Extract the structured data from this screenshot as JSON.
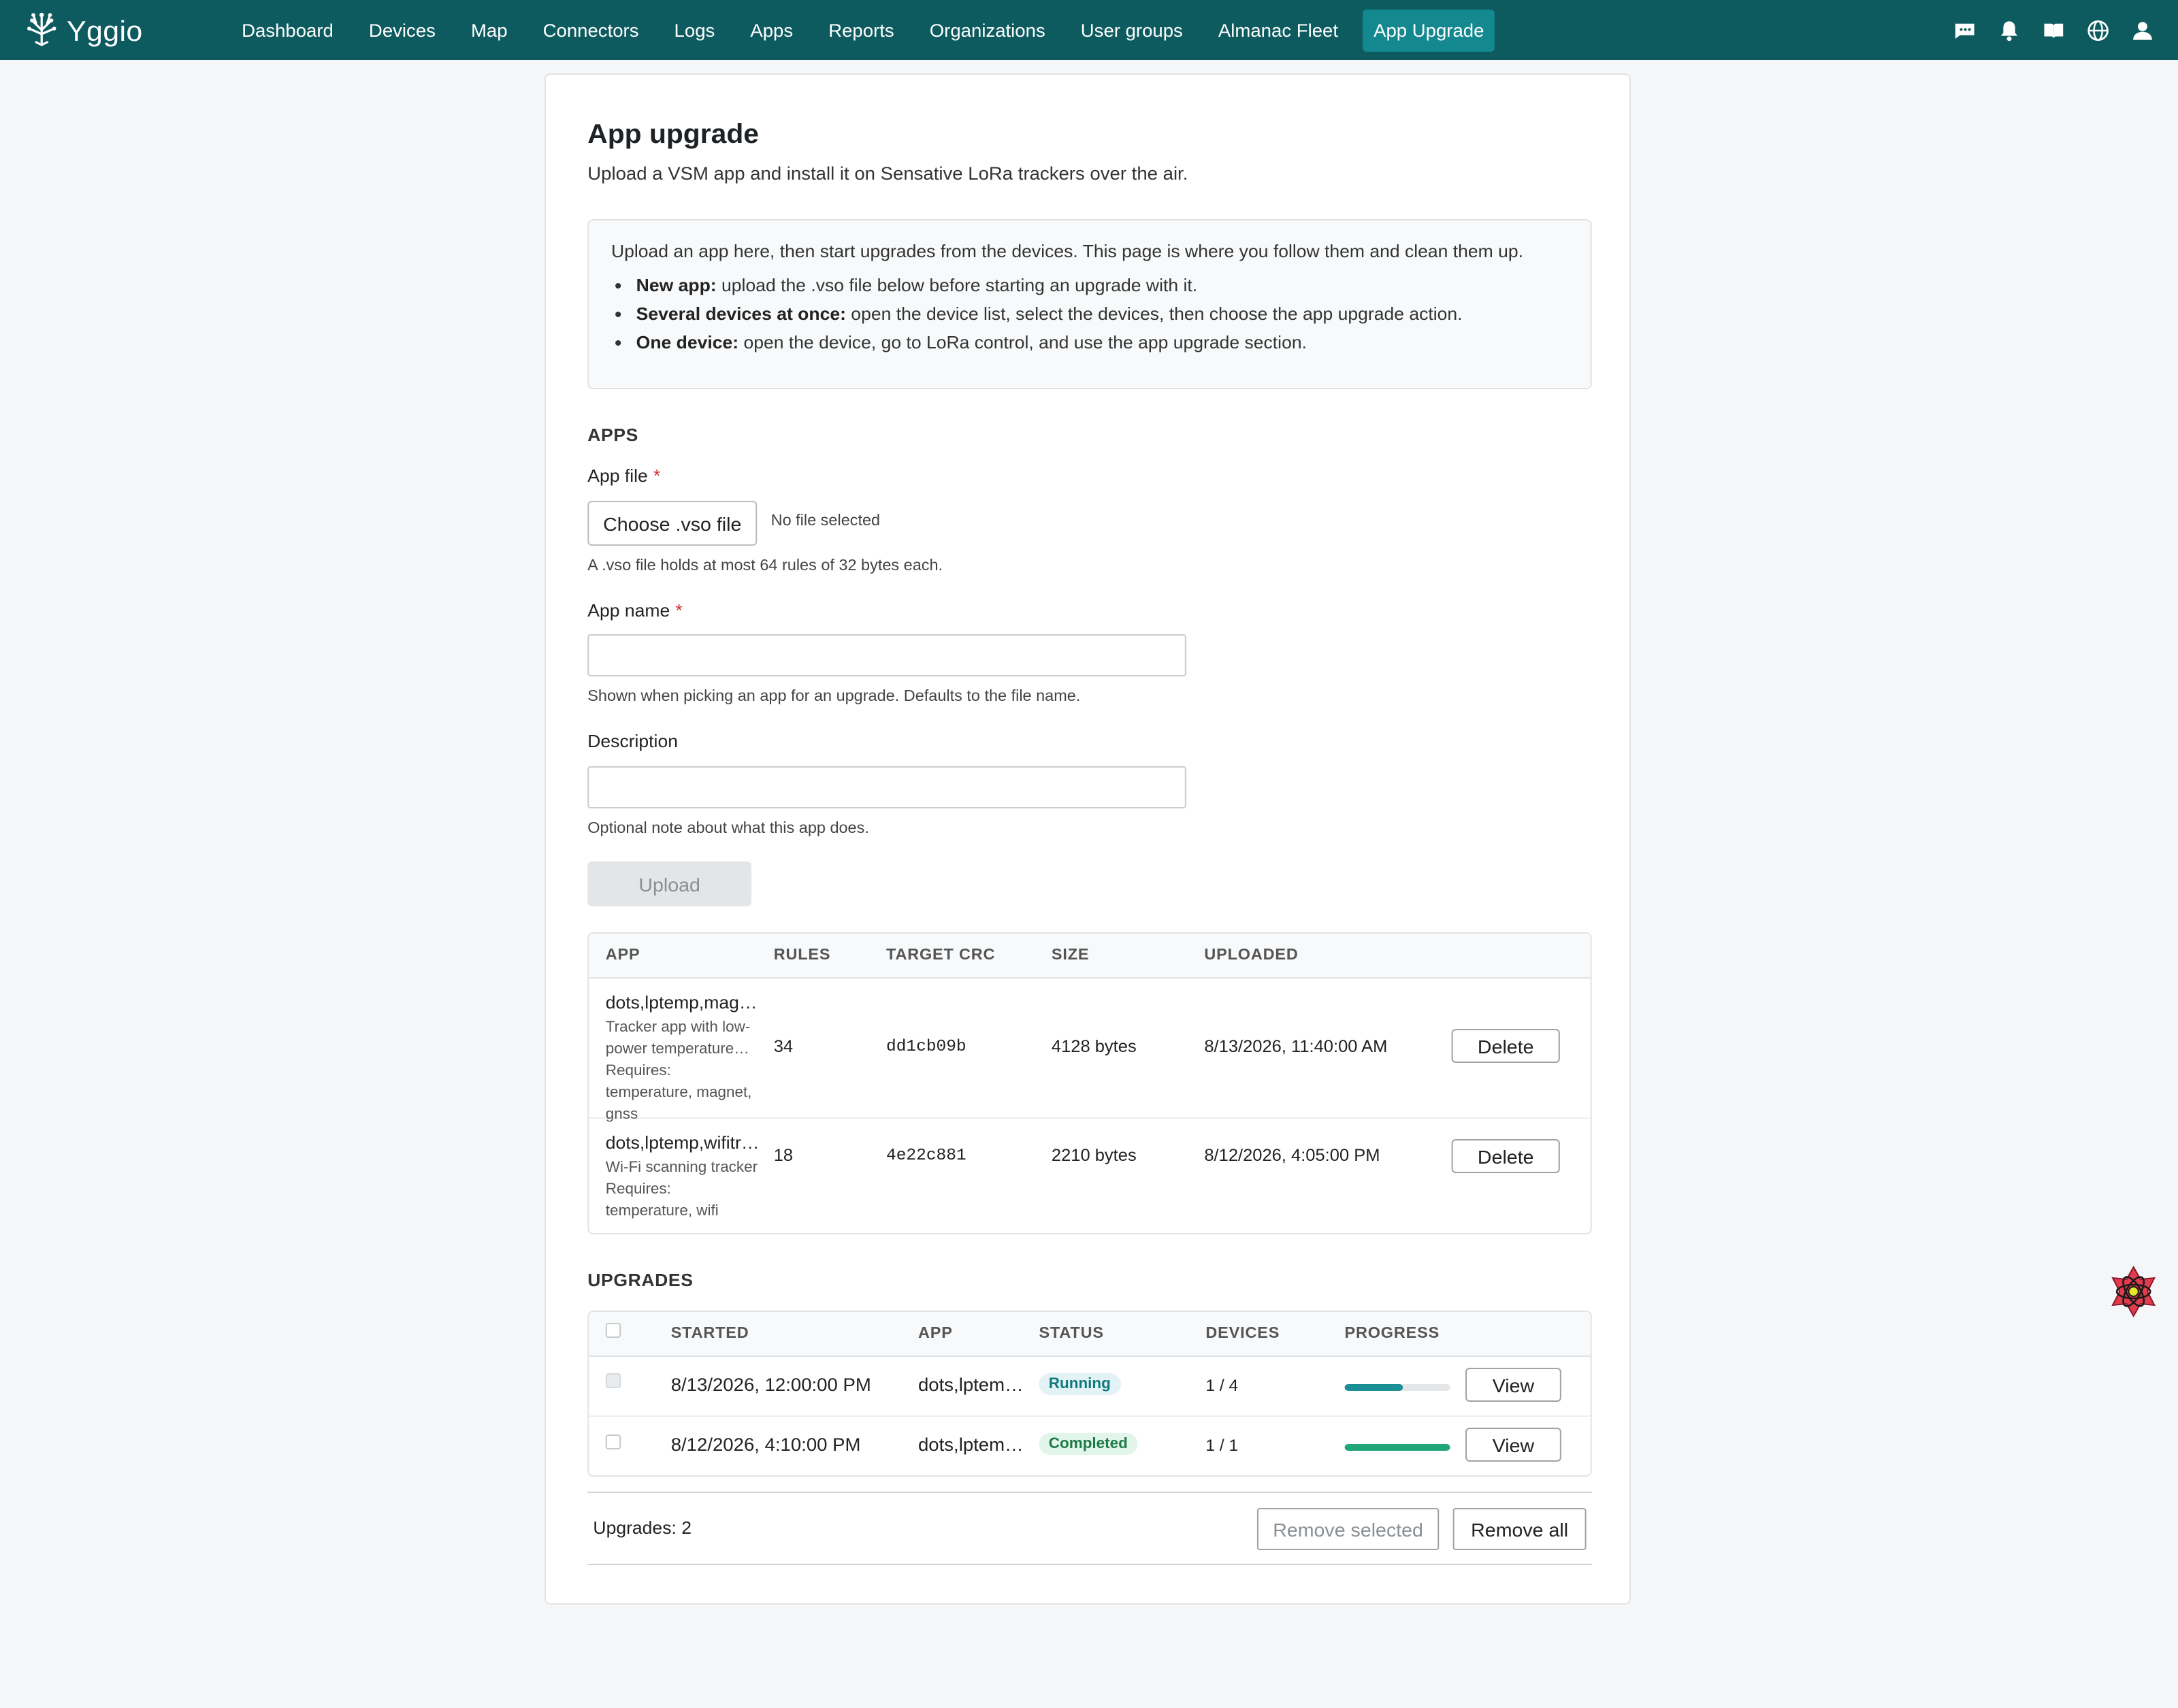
{
  "brand": {
    "name": "Yggio"
  },
  "nav": {
    "items": [
      "Dashboard",
      "Devices",
      "Map",
      "Connectors",
      "Logs",
      "Apps",
      "Reports",
      "Organizations",
      "User groups",
      "Almanac Fleet",
      "App Upgrade"
    ],
    "active": "App Upgrade",
    "icons": [
      "message-icon",
      "bell-icon",
      "book-icon",
      "globe-icon",
      "user-icon"
    ]
  },
  "page": {
    "title": "App upgrade",
    "subtitle": "Upload a VSM app and install it on Sensative LoRa trackers over the air."
  },
  "info": {
    "intro": "Upload an app here, then start upgrades from the devices. This page is where you follow them and clean them up.",
    "bullets": [
      {
        "label": "New app:",
        "text": "upload the .vso file below before starting an upgrade with it."
      },
      {
        "label": "Several devices at once:",
        "text": "open the device list, select the devices, then choose the app upgrade action."
      },
      {
        "label": "One device:",
        "text": "open the device, go to LoRa control, and use the app upgrade section."
      }
    ]
  },
  "apps_section": {
    "heading": "APPS",
    "file_label": "App file",
    "required_mark": "*",
    "file_button": "Choose .vso file",
    "file_status": "No file selected",
    "file_help": "A .vso file holds at most 64 rules of 32 bytes each.",
    "name_label": "App name",
    "name_value": "",
    "name_help": "Shown when picking an app for an upgrade. Defaults to the file name.",
    "desc_label": "Description",
    "desc_value": "",
    "desc_help": "Optional note about what this app does.",
    "upload_button": "Upload"
  },
  "apps_table": {
    "headers": [
      "APP",
      "RULES",
      "TARGET CRC",
      "SIZE",
      "UPLOADED"
    ],
    "rows": [
      {
        "name": "dots,lptemp,magnet,gnss",
        "description": "Tracker app with low-power temperature logging",
        "requires": "Requires: temperature, magnet, gnss",
        "rules": "34",
        "crc": "dd1cb09b",
        "size": "4128 bytes",
        "uploaded": "8/13/2026, 11:40:00 AM",
        "action": "Delete"
      },
      {
        "name": "dots,lptemp,wifitracker",
        "description": "Wi-Fi scanning tracker",
        "requires": "Requires: temperature, wifi",
        "rules": "18",
        "crc": "4e22c881",
        "size": "2210 bytes",
        "uploaded": "8/12/2026, 4:05:00 PM",
        "action": "Delete"
      }
    ]
  },
  "upgrades_section": {
    "heading": "UPGRADES"
  },
  "upgrades_table": {
    "headers": [
      "STARTED",
      "APP",
      "STATUS",
      "DEVICES",
      "PROGRESS"
    ],
    "rows": [
      {
        "started": "8/13/2026, 12:00:00 PM",
        "app": "dots,lptemp,magnet,gnss",
        "status": "Running",
        "devices": "1 / 4",
        "progress": 0.55,
        "selectable": false,
        "action": "View"
      },
      {
        "started": "8/12/2026, 4:10:00 PM",
        "app": "dots,lptemp,wifitracker",
        "status": "Completed",
        "devices": "1 / 1",
        "progress": 1.0,
        "selectable": true,
        "action": "View"
      }
    ]
  },
  "footer": {
    "count": "Upgrades: 2",
    "remove_selected": "Remove selected",
    "remove_all": "Remove all"
  },
  "colors": {
    "nav_bg": "#0d5b5f",
    "nav_active": "#14888f",
    "progress_running": "#1a8f96",
    "progress_completed": "#20a67a"
  }
}
